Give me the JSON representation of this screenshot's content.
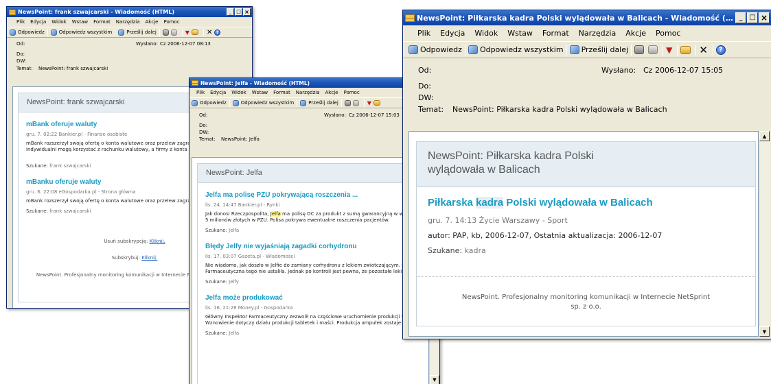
{
  "colors": {
    "title_gradient": "#1d57b8",
    "article_link": "#1a9bc2",
    "highlight": "#fff58a",
    "card_header_bg": "#e6eef4",
    "window_bg": "#ece9d8"
  },
  "window_controls": {
    "minimize": "_",
    "maximize": "□",
    "close": "×"
  },
  "menu": [
    "Plik",
    "Edycja",
    "Widok",
    "Wstaw",
    "Format",
    "Narzędzia",
    "Akcje",
    "Pomoc"
  ],
  "toolbar": {
    "reply": "Odpowiedz",
    "reply_all": "Odpowiedz wszystkim",
    "forward": "Prześlij dalej",
    "icons": [
      "print-icon",
      "copy-icon",
      "flag-icon",
      "folder-icon",
      "delete-icon",
      "help-icon"
    ]
  },
  "headers": {
    "from": "Od:",
    "to": "Do:",
    "cc": "DW:",
    "subject_label": "Temat:",
    "sent_label": "Wysłano:"
  },
  "win1": {
    "title": "NewsPoint: frank szwajcarski - Wiadomość (HTML)",
    "sent": "Cz 2006-12-07 08:13",
    "subject": "NewsPoint: frank szwajcarski",
    "card_title": "NewsPoint: frank szwajcarski",
    "articles": [
      {
        "title": "mBank oferuje waluty",
        "meta": "gru. 7. 02:22 Bankier.pl - Finanse osobiste",
        "body": "mBank rozszerzył swoją ofertę o konta walutowe oraz przelew zagraniczne. Klienci indywidualni mogą korzystać z rachunku walutowy, a firmy z konta mBIZNES ...",
        "found_label": "Szukane:",
        "found": "frank szwajcarski"
      },
      {
        "title": "mBanku oferuje waluty",
        "meta": "gru. 6. 22:08 eGospodarka.pl - Strona główna",
        "body": "mBank rozszerzył swoją ofertę o konta walutowe oraz przelew zagraniczne.",
        "found_label": "Szukane:",
        "found": "frank szwajcarski"
      }
    ],
    "unsub_text": "Usuń subskrypcję:",
    "unsub_link": "Kliknij.",
    "sub_text": "Subskrybuj:",
    "sub_link": "Kliknij.",
    "footer": "NewsPoint. Profesjonalny monitoring komunikacji w Internecie NetSprint sp. z o.o."
  },
  "win2": {
    "title": "NewsPoint: Jelfa - Wiadomość (HTML)",
    "sent": "Cz 2006-12-07 15:03",
    "subject": "NewsPoint: Jelfa",
    "card_title": "NewsPoint: Jelfa",
    "articles": [
      {
        "title": "Jelfa ma polisę PZU pokrywającą roszczenia ...",
        "meta": "lis. 24. 14:47 Bankier.pl - Rynki",
        "body_pre": "Jak donosi Rzeczpospolita, ",
        "body_hl": "Jelfa",
        "body_post": " ma polisę OC za produkt z sumą gwarancyjną w wysokości 5 milionów złotych w PZU. Polisa pokrywa ewentualne roszczenia pacjentów.",
        "found_label": "Szukane:",
        "found": "Jelfa"
      },
      {
        "title": "Błędy Jelfy nie wyjaśniają zagadki corhydronu",
        "meta": "lis. 17. 03:07 Gazeta.pl - Wiadomości",
        "body": "Nie wiadomo, jak doszło w Jelfie do zamiany corhydronu z lekiem zwiotczającym. Inspekcja Farmaceutyczna tego nie ustaliła. Jednak po kontroli jest pewna, że pozostałe leki z ...",
        "found_label": "Szukane:",
        "found": "Jelfy"
      },
      {
        "title": "Jelfa może produkować",
        "meta": "lis. 16. 21:28 Money.pl - Gospodarka",
        "body": "Główny Inspektor Farmaceutyczny zezwolił na częściowe uruchomienie produkcji w Jelfie. Wznowienie dotyczy działu produkcji tabletek i maści. Produkcja ampułek zostaje w ...",
        "found_label": "Szukane:",
        "found": "Jelfa"
      }
    ]
  },
  "win3": {
    "title": "NewsPoint: Piłkarska kadra Polski wylądowała w Balicach - Wiadomość (H...",
    "sent": "Cz 2006-12-07 15:05",
    "subject": "NewsPoint: Piłkarska kadra Polski wylądowała w Balicach",
    "card_title_line1": "NewsPoint: Piłkarska kadra Polski",
    "card_title_line2": "wylądowała w Balicach",
    "article": {
      "title_pre": "Piłkarska ",
      "title_hl": "kadra",
      "title_post": " Polski wylądowała w Balicach",
      "meta": "gru. 7. 14:13 Życie Warszawy - Sport",
      "author": "autor: PAP, kb, 2006-12-07, Ostatnia aktualizacja: 2006-12-07",
      "found_label": "Szukane:",
      "found": "kadra"
    },
    "footer_line1": "NewsPoint. Profesjonalny monitoring komunikacji w Internecie NetSprint",
    "footer_line2": "sp. z o.o."
  }
}
